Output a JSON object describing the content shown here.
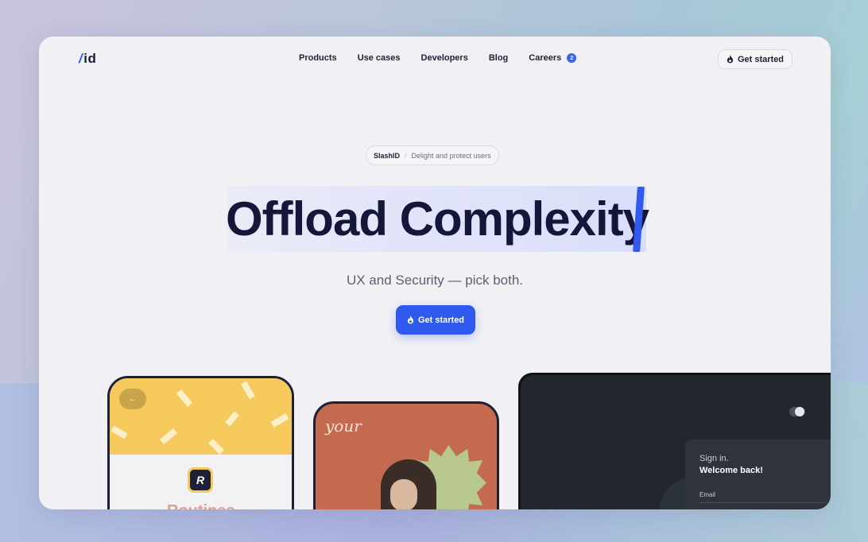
{
  "nav": {
    "logo_slash": "/",
    "logo_text": "id",
    "links": [
      {
        "label": "Products"
      },
      {
        "label": "Use cases"
      },
      {
        "label": "Developers"
      },
      {
        "label": "Blog"
      },
      {
        "label": "Careers",
        "badge": "2"
      }
    ],
    "cta_label": "Get started",
    "cta_icon": "flame-icon"
  },
  "hero": {
    "pill_brand": "SlashID",
    "pill_separator": "/",
    "pill_tag": "Delight and protect users",
    "headline": "Offload Complexity",
    "subheadline": "UX and Security — pick both.",
    "cta_label": "Get started",
    "cta_icon": "flame-icon"
  },
  "devices": {
    "phone1": {
      "back_arrow": "←",
      "app_letter": "R",
      "title": "Routines"
    },
    "phone2": {
      "script_text": "your"
    },
    "laptop": {
      "signin_title": "Sign in.",
      "welcome": "Welcome back!",
      "email_label": "Email"
    }
  },
  "colors": {
    "accent": "#3059ee",
    "ink": "#15173a",
    "page_bg": "#f1f1f5",
    "phone1_top": "#f5c95c",
    "phone2_bg": "#c46b4f",
    "laptop_bg": "#22272e"
  }
}
